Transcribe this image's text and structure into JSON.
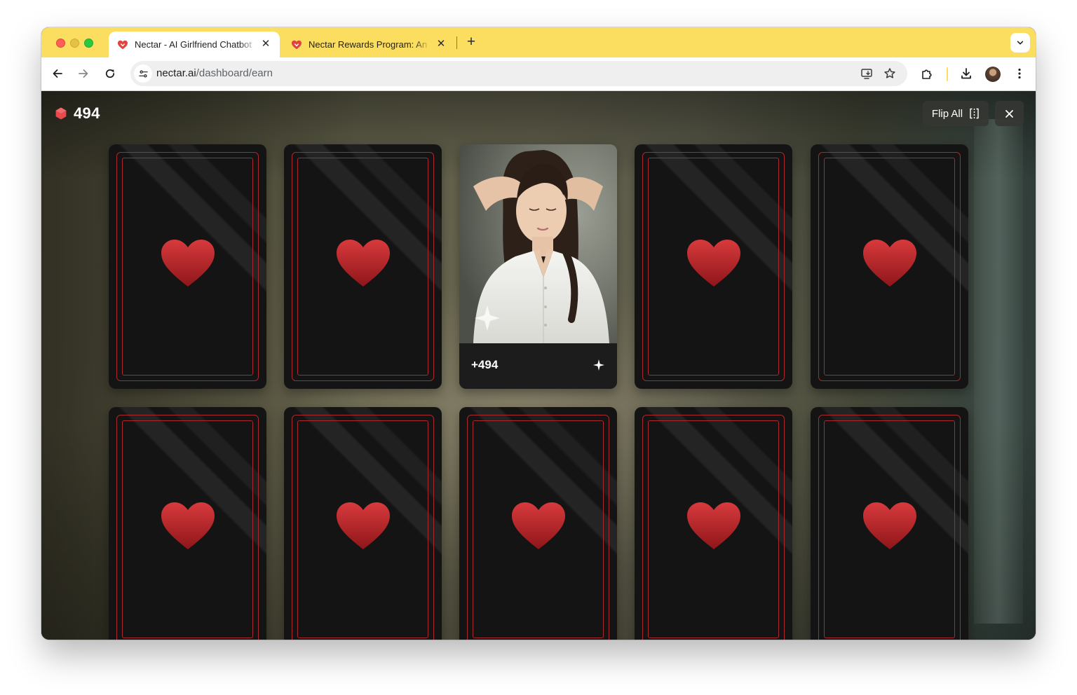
{
  "browser": {
    "tabs": [
      {
        "title": "Nectar - AI Girlfriend Chatbot",
        "active": true,
        "favicon": "nectar-heart-icon"
      },
      {
        "title": "Nectar Rewards Program: An",
        "active": false,
        "favicon": "nectar-heart-icon"
      }
    ],
    "url": {
      "host": "nectar.ai",
      "path": "/dashboard/earn"
    }
  },
  "header": {
    "balance": "494",
    "flip_all_label": "Flip All"
  },
  "cards": {
    "revealed_reward": "+494",
    "rows": [
      [
        "hidden",
        "hidden",
        "revealed",
        "hidden",
        "hidden"
      ],
      [
        "hidden",
        "hidden",
        "hidden",
        "hidden",
        "hidden"
      ]
    ]
  },
  "colors": {
    "tabstrip": "#fbde5f",
    "card_back": "#141414",
    "card_border": "#a9292e",
    "heart": "#c8282e",
    "balance_gem": "#e84a4d"
  }
}
